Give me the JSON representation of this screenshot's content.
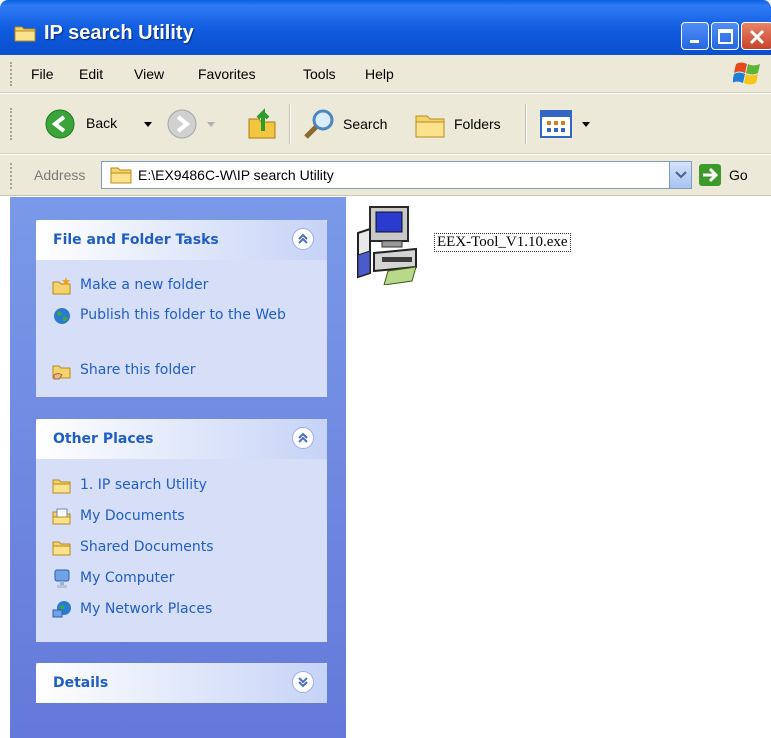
{
  "window": {
    "title": "IP search Utility"
  },
  "menu": {
    "items": [
      "File",
      "Edit",
      "View",
      "Favorites",
      "Tools",
      "Help"
    ]
  },
  "toolbar": {
    "back_label": "Back",
    "search_label": "Search",
    "folders_label": "Folders"
  },
  "address": {
    "label": "Address",
    "value": "E:\\EX9486C-W\\IP search Utility",
    "go_label": "Go"
  },
  "taskpane": {
    "file_tasks": {
      "title": "File and Folder Tasks",
      "items": [
        {
          "label": "Make a new folder",
          "icon": "new-folder-icon"
        },
        {
          "label": "Publish this folder to the Web",
          "icon": "globe-icon"
        },
        {
          "label": "Share this folder",
          "icon": "share-folder-icon"
        }
      ]
    },
    "other_places": {
      "title": "Other Places",
      "items": [
        {
          "label": "1. IP search Utility",
          "icon": "folder-icon"
        },
        {
          "label": "My Documents",
          "icon": "my-documents-icon"
        },
        {
          "label": "Shared Documents",
          "icon": "folder-icon"
        },
        {
          "label": "My Computer",
          "icon": "my-computer-icon"
        },
        {
          "label": "My Network Places",
          "icon": "network-places-icon"
        }
      ]
    },
    "details": {
      "title": "Details"
    }
  },
  "files": [
    {
      "name": "EEX-Tool_V1.10.exe",
      "icon": "installer-exe-icon"
    }
  ],
  "colors": {
    "titlebar": "#0f5ade",
    "taskpane_bg": "#6f8ae0",
    "panel_bg": "#d6dff7",
    "link": "#215dc6"
  }
}
